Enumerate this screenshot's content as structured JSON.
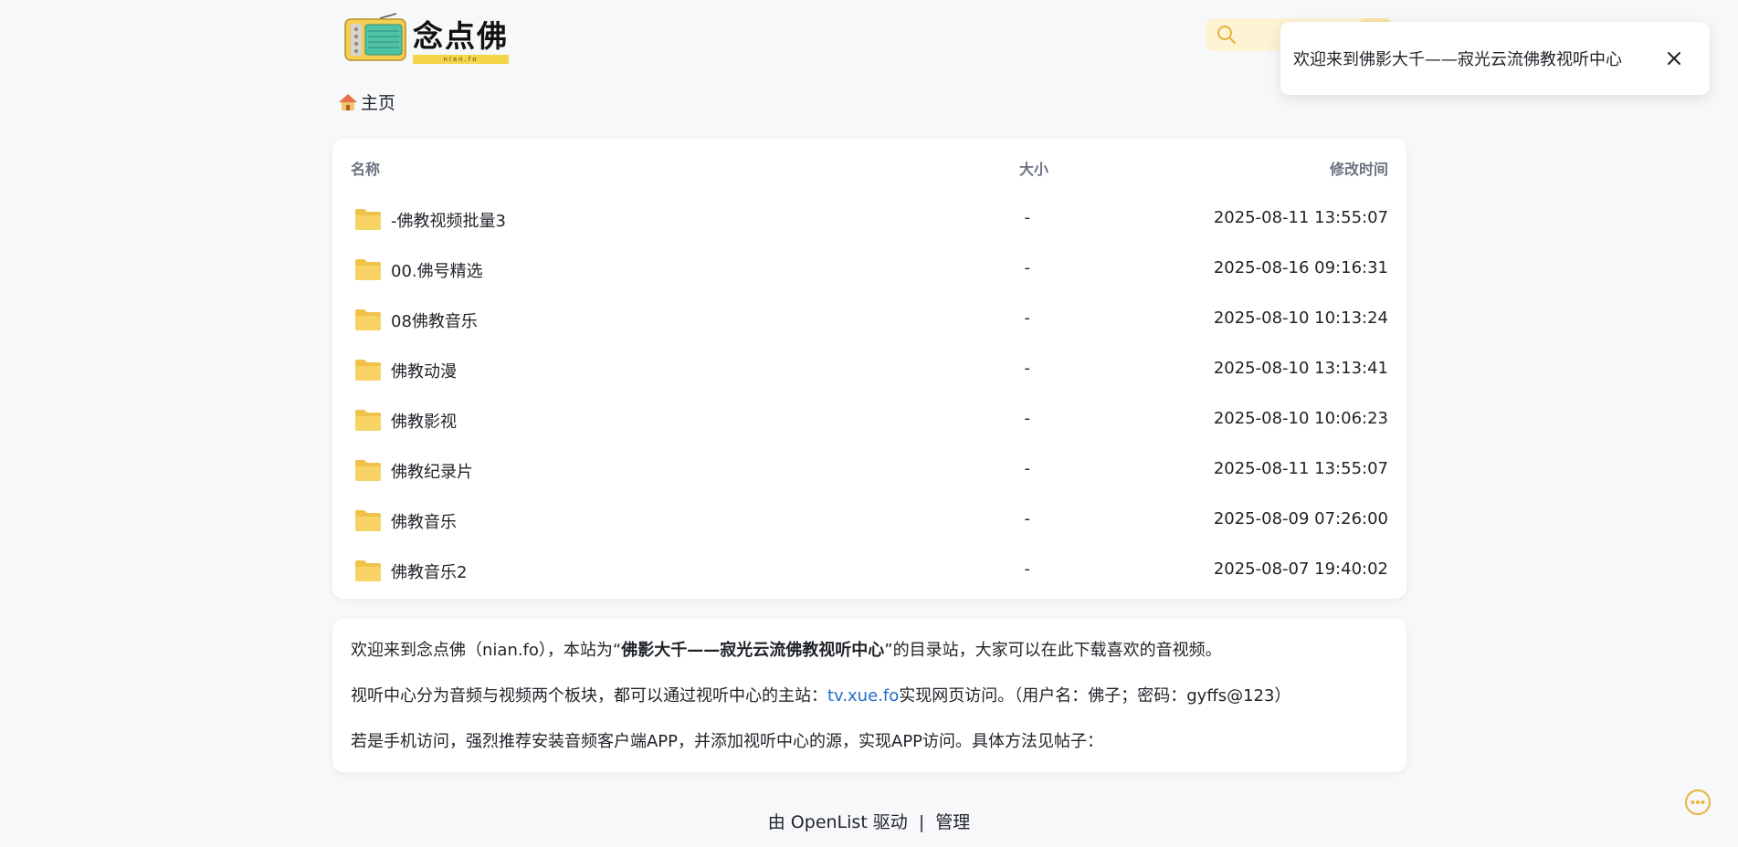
{
  "header": {
    "logo_text": "念点佛",
    "logo_subtext": "nian.fo",
    "search_icon": "search-icon"
  },
  "breadcrumb": {
    "home_label": "主页",
    "home_icon": "home-icon"
  },
  "file_list": {
    "columns": {
      "name": "名称",
      "size": "大小",
      "modified": "修改时间"
    },
    "rows": [
      {
        "name": "-佛教视频批量3",
        "size": "-",
        "modified": "2025-08-11 13:55:07",
        "icon": "folder-icon"
      },
      {
        "name": "00.佛号精选",
        "size": "-",
        "modified": "2025-08-16 09:16:31",
        "icon": "folder-icon"
      },
      {
        "name": "08佛教音乐",
        "size": "-",
        "modified": "2025-08-10 10:13:24",
        "icon": "folder-icon"
      },
      {
        "name": "佛教动漫",
        "size": "-",
        "modified": "2025-08-10 13:13:41",
        "icon": "folder-icon"
      },
      {
        "name": "佛教影视",
        "size": "-",
        "modified": "2025-08-10 10:06:23",
        "icon": "folder-icon"
      },
      {
        "name": "佛教纪录片",
        "size": "-",
        "modified": "2025-08-11 13:55:07",
        "icon": "folder-icon"
      },
      {
        "name": "佛教音乐",
        "size": "-",
        "modified": "2025-08-09 07:26:00",
        "icon": "folder-icon"
      },
      {
        "name": "佛教音乐2",
        "size": "-",
        "modified": "2025-08-07 19:40:02",
        "icon": "folder-icon"
      }
    ]
  },
  "readme": {
    "line1_pre": "欢迎来到念点佛（nian.fo），本站为“",
    "line1_bold": "佛影大千——寂光云流佛教视听中心",
    "line1_post": "”的目录站，大家可以在此下载喜欢的音视频。",
    "line2_pre": "视听中心分为音频与视频两个板块，都可以通过视听中心的主站：",
    "line2_link": "tv.xue.fo",
    "line2_post": "实现网页访问。（用户名：佛子；密码：gyffs@123）",
    "line3": "若是手机访问，强烈推荐安装音频客户端APP，并添加视听中心的源，实现APP访问。具体方法见帖子："
  },
  "footer": {
    "powered_by": "由 OpenList 驱动",
    "separator": "|",
    "manage": "管理"
  },
  "toast": {
    "message": "欢迎来到佛影大千——寂光云流佛教视听中心",
    "close_icon": "close-icon"
  },
  "colors": {
    "accent_yellow": "#f5d54a",
    "folder_yellow": "#f7cf5a",
    "link_blue": "#1f6fc9",
    "background": "#f7f8fa"
  }
}
